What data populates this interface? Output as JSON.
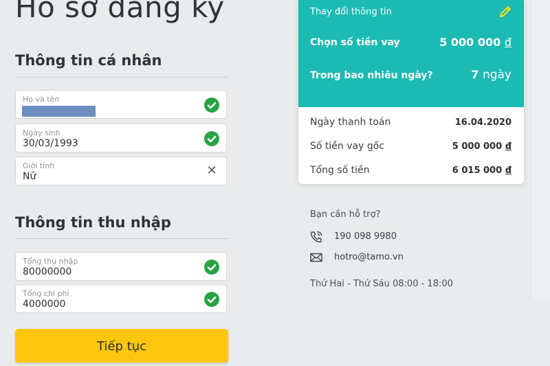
{
  "page": {
    "title": "Hồ sơ đăng ký"
  },
  "personal": {
    "section_title": "Thông tin cá nhân",
    "full_name": {
      "label": "Họ và tên",
      "value": ""
    },
    "dob": {
      "label": "Ngày sinh",
      "value": "30/03/1993"
    },
    "gender": {
      "label": "Giới tính",
      "value": "Nữ"
    }
  },
  "income": {
    "section_title": "Thông tin thu nhập",
    "total_income": {
      "label": "Tổng thu nhập",
      "value": "80000000"
    },
    "total_expense": {
      "label": "Tổng chi phí",
      "value": "4000000"
    }
  },
  "actions": {
    "continue_label": "Tiếp tục"
  },
  "loan_card": {
    "change_info": "Thay đổi thông tin",
    "amount_label": "Chọn số tiền vay",
    "amount_value": "5 000 000",
    "amount_unit": "đ",
    "days_label": "Trong bao nhiêu ngày?",
    "days_value": "7",
    "days_unit": "ngày",
    "payment_date_label": "Ngày thanh toán",
    "payment_date_value": "16.04.2020",
    "principal_label": "Số tiền vay gốc",
    "principal_value": "5 000 000",
    "principal_unit": "đ",
    "total_label": "Tổng số tiền",
    "total_value": "6 015 000",
    "total_unit": "đ"
  },
  "support": {
    "title": "Bạn cần hỗ trợ?",
    "phone": "190 098 9980",
    "email": "hotro@tamo.vn",
    "hours": "Thứ Hai - Thứ Sáu 08:00 - 18:00"
  },
  "icons": {
    "valid": "check-circle-icon",
    "clear": "close-icon",
    "edit": "pencil-icon",
    "phone": "phone-icon",
    "email": "envelope-icon"
  },
  "colors": {
    "background": "#e9ebec",
    "teal": "#1bbab2",
    "button_yellow": "#fcc60e",
    "check_green": "#27a444",
    "pencil_yellow": "#f5e31a"
  }
}
